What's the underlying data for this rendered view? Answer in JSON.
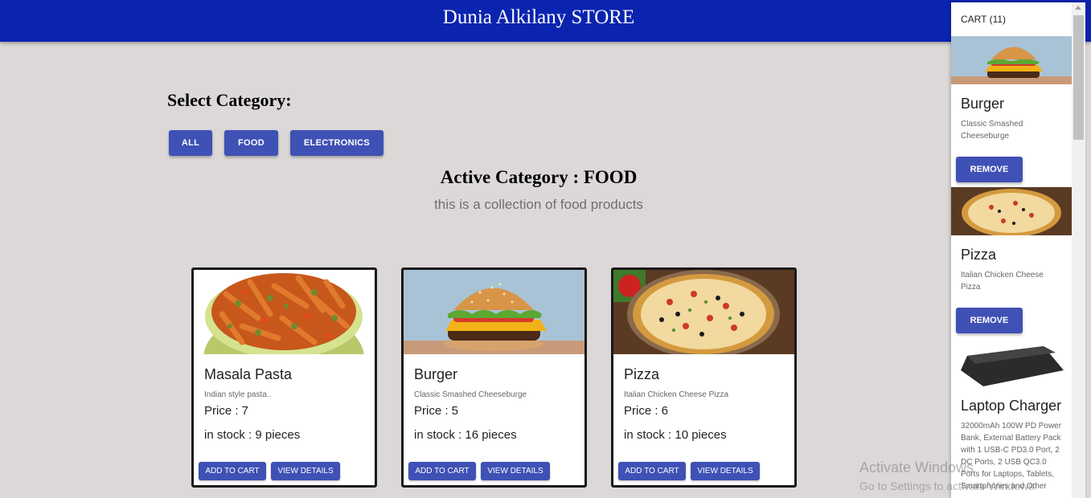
{
  "header": {
    "title": "Dunia Alkilany STORE",
    "bg_color": "#0b24b0"
  },
  "categories": {
    "heading": "Select Category:",
    "buttons": [
      "ALL",
      "FOOD",
      "ELECTRONICS"
    ],
    "active_label": "Active Category : FOOD",
    "description": "this is a collection of food products"
  },
  "products": [
    {
      "name": "Masala Pasta",
      "description": "Indian style pasta..",
      "price": "Price : 7",
      "stock": "in stock : 9 pieces",
      "add_label": "ADD TO CART",
      "details_label": "VIEW DETAILS",
      "image": "pasta-image"
    },
    {
      "name": "Burger",
      "description": "Classic Smashed Cheeseburge",
      "price": "Price : 5",
      "stock": "in stock : 16 pieces",
      "add_label": "ADD TO CART",
      "details_label": "VIEW DETAILS",
      "image": "burger-image"
    },
    {
      "name": "Pizza",
      "description": "Italian Chicken Cheese Pizza",
      "price": "Price : 6",
      "stock": "in stock : 10 pieces",
      "add_label": "ADD TO CART",
      "details_label": "VIEW DETAILS",
      "image": "pizza-image"
    }
  ],
  "cart": {
    "title": "CART (11)",
    "items": [
      {
        "name": "Burger",
        "description": "Classic Smashed Cheeseburge",
        "remove_label": "REMOVE"
      },
      {
        "name": "Pizza",
        "description": "Italian Chicken Cheese Pizza",
        "remove_label": "REMOVE"
      },
      {
        "name": "Laptop Charger",
        "description": "32000mAh 100W PD Power Bank, External Battery Pack with 1 USB-C PD3.0 Port, 2 DC Ports, 2 USB QC3.0 Ports for Laptops, Tablets, Smartphones and Other"
      }
    ]
  },
  "watermark": {
    "line1": "Activate Windows",
    "line2": "Go to Settings to activate Windows."
  },
  "colors": {
    "accent": "#3f51b5",
    "page_bg": "#dcd8d8"
  }
}
